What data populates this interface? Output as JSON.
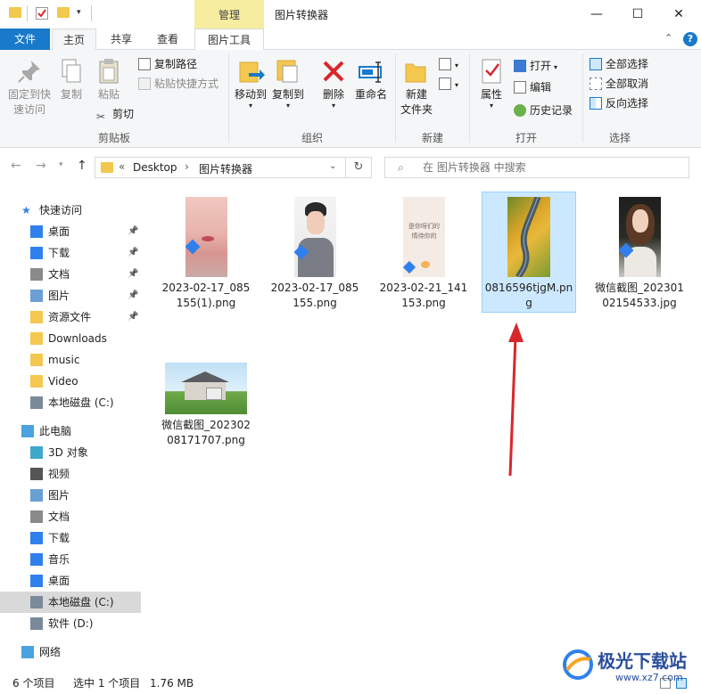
{
  "window": {
    "title": "图片转换器",
    "context_tab_header": "管理",
    "minimize_glyph": "—",
    "maximize_glyph": "☐",
    "close_glyph": "✕"
  },
  "tabs": {
    "file": "文件",
    "home": "主页",
    "share": "共享",
    "view": "查看",
    "picture_tools": "图片工具"
  },
  "ribbon": {
    "clipboard": {
      "label": "剪贴板",
      "pin_quick_access_l1": "固定到快",
      "pin_quick_access_l2": "速访问",
      "copy": "复制",
      "paste": "粘贴",
      "copy_path": "复制路径",
      "paste_shortcut": "粘贴快捷方式",
      "cut": "剪切"
    },
    "organize": {
      "label": "组织",
      "move_to": "移动到",
      "copy_to": "复制到",
      "delete": "删除",
      "rename": "重命名"
    },
    "new": {
      "label": "新建",
      "new_folder_l1": "新建",
      "new_folder_l2": "文件夹"
    },
    "open": {
      "label": "打开",
      "properties": "属性",
      "open": "打开",
      "edit": "编辑",
      "history": "历史记录"
    },
    "select": {
      "label": "选择",
      "select_all": "全部选择",
      "select_none": "全部取消",
      "invert": "反向选择"
    }
  },
  "address": {
    "prefix": "«",
    "crumb1": "Desktop",
    "sep": "›",
    "crumb2": "图片转换器"
  },
  "search": {
    "placeholder": "在 图片转换器 中搜索"
  },
  "nav": {
    "quick_access": "快速访问",
    "items": [
      {
        "label": "桌面",
        "pinned": true
      },
      {
        "label": "下载",
        "pinned": true
      },
      {
        "label": "文档",
        "pinned": true
      },
      {
        "label": "图片",
        "pinned": true
      },
      {
        "label": "资源文件",
        "pinned": true
      },
      {
        "label": "Downloads",
        "pinned": false
      },
      {
        "label": "music",
        "pinned": false
      },
      {
        "label": "Video",
        "pinned": false
      },
      {
        "label": "本地磁盘 (C:)",
        "pinned": false
      }
    ],
    "this_pc": "此电脑",
    "pc_items": [
      "3D 对象",
      "视频",
      "图片",
      "文档",
      "下载",
      "音乐",
      "桌面",
      "本地磁盘 (C:)",
      "软件 (D:)"
    ],
    "network": "网络"
  },
  "files": [
    {
      "name": "2023-02-17_085155(1).png",
      "selected": false
    },
    {
      "name": "2023-02-17_085155.png",
      "selected": false
    },
    {
      "name": "2023-02-21_141153.png",
      "selected": false
    },
    {
      "name": "0816596tjgM.png",
      "selected": true
    },
    {
      "name": "微信截图_20230102154533.jpg",
      "selected": false
    },
    {
      "name": "微信截图_20230208171707.png",
      "selected": false
    }
  ],
  "thumb3_text": "是你呀们的 情待你的",
  "status": {
    "count": "6 个项目",
    "selection": "选中 1 个项目",
    "size": "1.76 MB"
  },
  "watermark": {
    "text": "极光下载站",
    "url": "www.xz7.com"
  },
  "colors": {
    "accent": "#1979ca",
    "selection": "#cce8ff",
    "arrow": "#d9262b",
    "context_tab": "#f7eda0"
  }
}
